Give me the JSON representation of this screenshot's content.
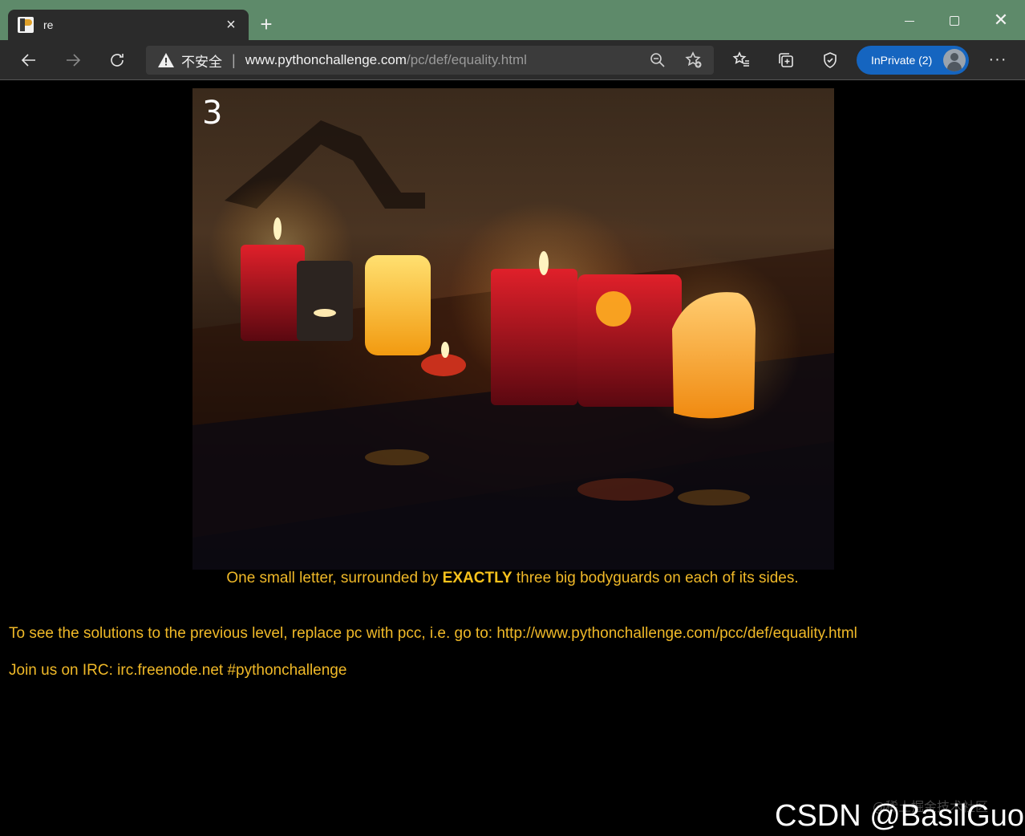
{
  "browser": {
    "tab": {
      "title": "re",
      "close": "×"
    },
    "new_tab": "+",
    "window_controls": {
      "close": "✕"
    },
    "address": {
      "security_label": "不安全",
      "separator": "|",
      "url_host": "www.pythonchallenge.com",
      "url_path": "/pc/def/equality.html"
    },
    "profile": {
      "label": "InPrivate (2)"
    },
    "more": "···",
    "icons": [
      "back-icon",
      "forward-icon",
      "refresh-icon",
      "warning-icon",
      "zoom-icon",
      "add-favorite-icon",
      "favorites-icon",
      "collections-icon",
      "browser-essentials-icon",
      "more-icon"
    ]
  },
  "page": {
    "image": {
      "number": "3"
    },
    "caption": {
      "before": "One small letter, surrounded by ",
      "emphasis": "EXACTLY",
      "after": " three big bodyguards on each of its sides."
    },
    "solutions_text": "To see the solutions to the previous level, replace pc with pcc, i.e. go to: http://www.pythonchallenge.com/pcc/def/equality.html",
    "irc_text": "Join us on IRC: irc.freenode.net #pythonchallenge",
    "text_color": "#f0b928"
  },
  "watermarks": {
    "juejin": "@稀土掘金技术社区",
    "csdn": "CSDN @BasilGuo"
  }
}
